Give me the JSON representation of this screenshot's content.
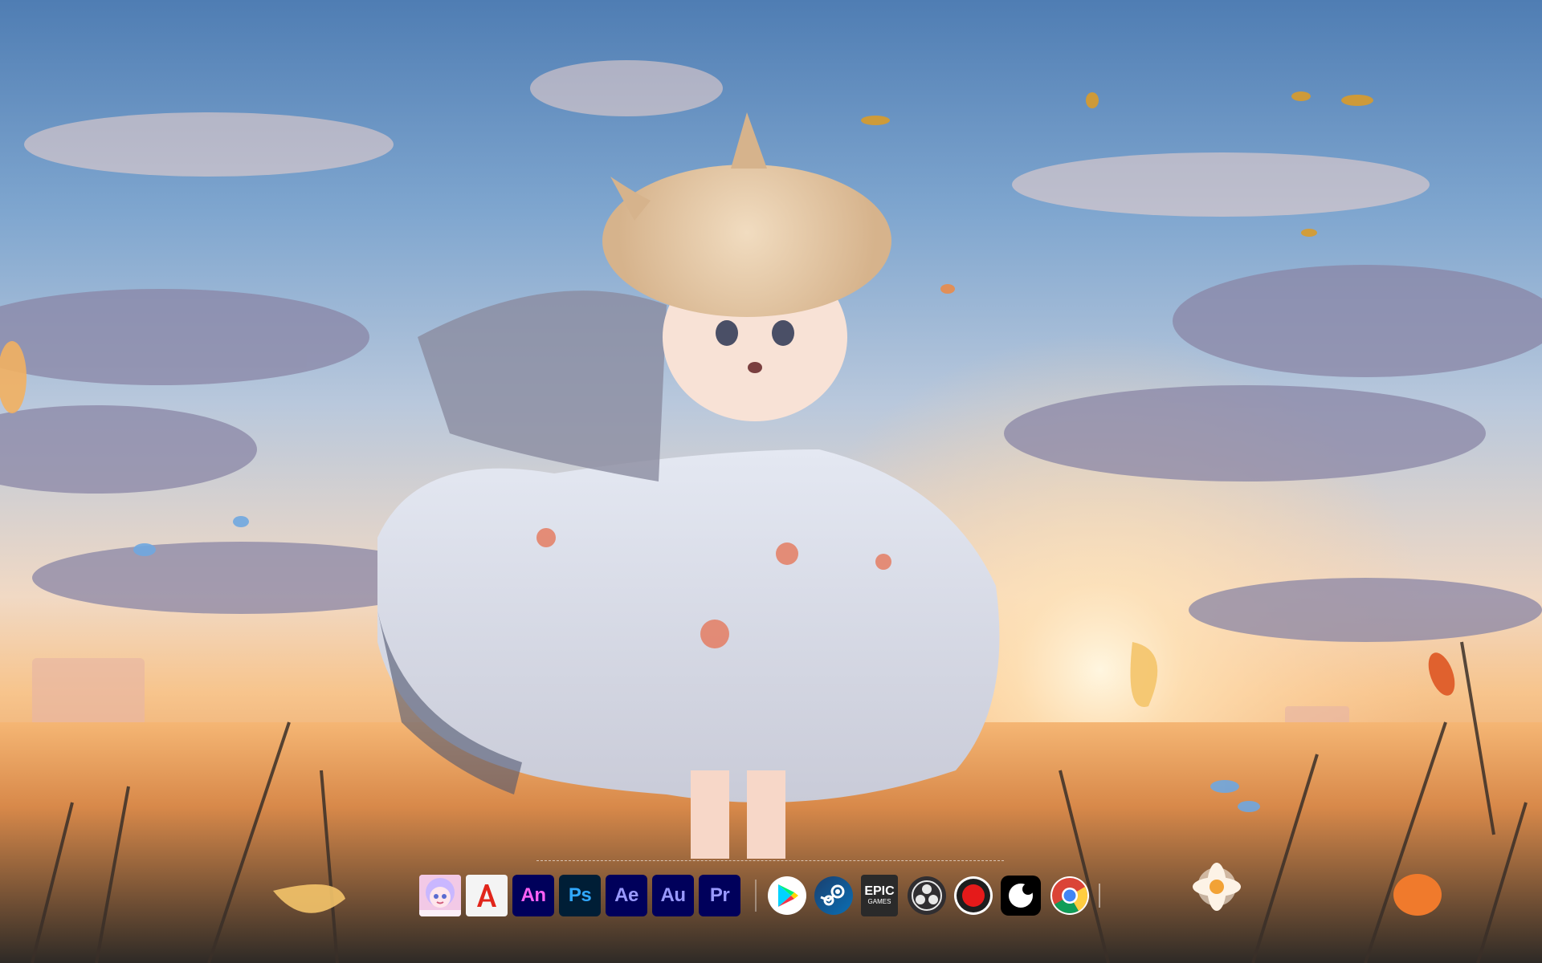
{
  "dock": {
    "apps": [
      {
        "id": "avatar",
        "icon": "anime-avatar-icon"
      },
      {
        "id": "acrobat",
        "icon": "acrobat-icon",
        "glyph": "A",
        "color": "#e1251b"
      },
      {
        "id": "animate",
        "label": "An",
        "color": "#ff61f6"
      },
      {
        "id": "photoshop",
        "label": "Ps",
        "color": "#31a8ff"
      },
      {
        "id": "aftereffects",
        "label": "Ae",
        "color": "#9999ff"
      },
      {
        "id": "audition",
        "label": "Au",
        "color": "#00e4bb"
      },
      {
        "id": "premiere",
        "label": "Pr",
        "color": "#9999ff"
      },
      {
        "id": "googleplay",
        "icon": "google-play-icon"
      },
      {
        "id": "steam",
        "icon": "steam-icon"
      },
      {
        "id": "epic",
        "label_line1": "EPIC",
        "label_line2": "GAMES",
        "icon": "epic-games-icon"
      },
      {
        "id": "obs",
        "icon": "obs-icon"
      },
      {
        "id": "recorder",
        "icon": "record-icon"
      },
      {
        "id": "capcut",
        "icon": "app-icon"
      },
      {
        "id": "chrome",
        "icon": "chrome-icon"
      }
    ]
  }
}
